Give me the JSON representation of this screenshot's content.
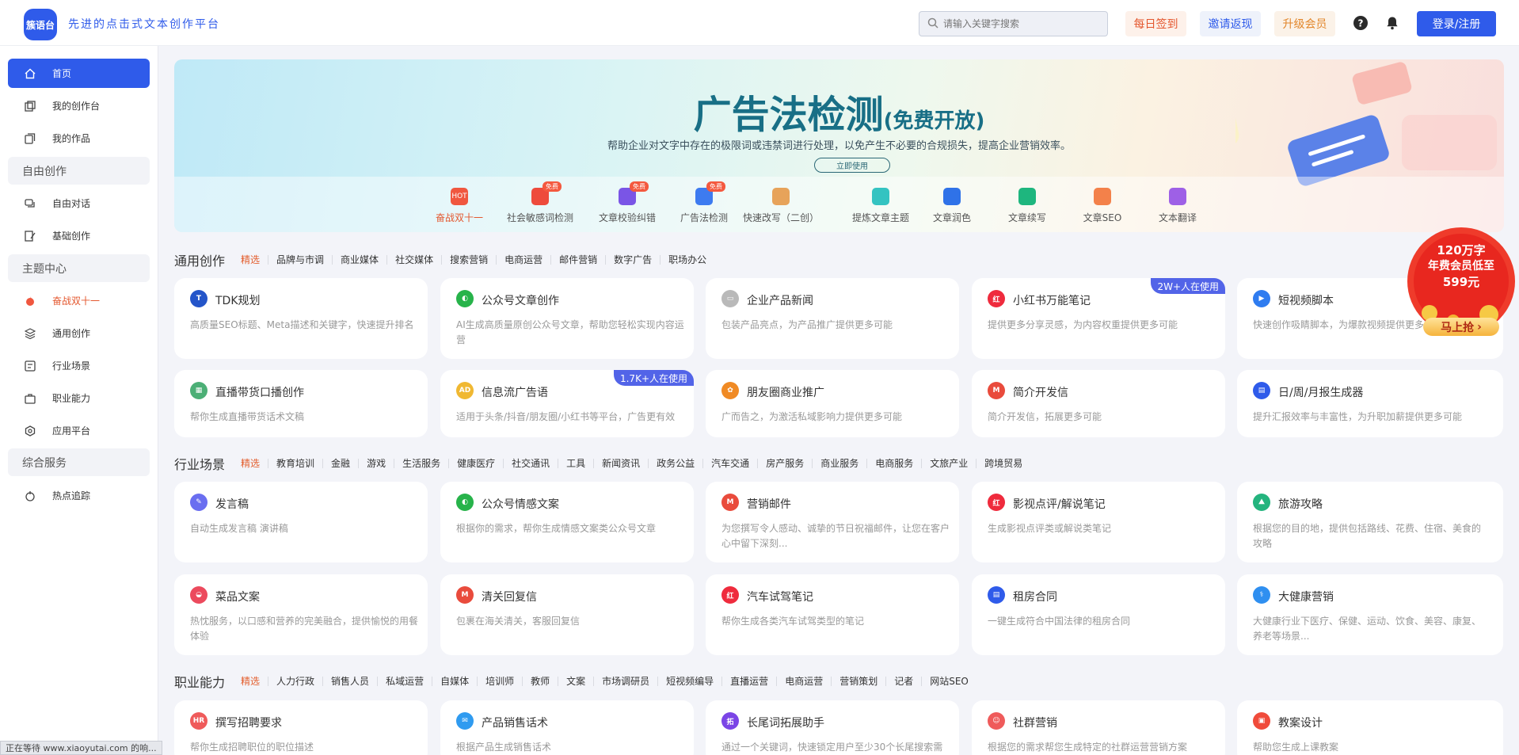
{
  "header": {
    "logo_text": "簇语台",
    "slogan": "先进的点击式文本创作平台",
    "search_placeholder": "请输入关键字搜索",
    "checkin": "每日签到",
    "invite": "邀请返现",
    "upgrade": "升级会员",
    "login": "登录/注册"
  },
  "sidebar": {
    "home": "首页",
    "workspace": "我的创作台",
    "works": "我的作品",
    "group_free": "自由创作",
    "free_chat": "自由对话",
    "basic": "基础创作",
    "group_theme": "主题中心",
    "double11": "奋战双十一",
    "general": "通用创作",
    "industry": "行业场景",
    "career": "职业能力",
    "platform": "应用平台",
    "group_service": "综合服务",
    "hot": "热点追踪"
  },
  "banner": {
    "title": "广告法检测",
    "title_suffix": "(免费开放)",
    "subtitle": "帮助企业对文字中存在的极限词或违禁词进行处理，以免产生不必要的合规损失，提高企业营销效率。",
    "button": "立即使用",
    "free_badge": "免费",
    "hot_badge": "HOT",
    "quick": [
      {
        "label": "奋战双十一",
        "color": "#f0573f",
        "icon": "fire-icon"
      },
      {
        "label": "社会敏感词检测",
        "color": "#ee4b3c",
        "icon": "shield-icon",
        "free": true
      },
      {
        "label": "文章校验纠错",
        "color": "#7a55e6",
        "icon": "check-icon",
        "free": true
      },
      {
        "label": "广告法检测",
        "color": "#3d7bf0",
        "icon": "ad-icon",
        "free": true
      },
      {
        "label": "快速改写（二创）",
        "color": "#e7a35a",
        "icon": "rewrite-icon"
      },
      {
        "label": "提炼文章主题",
        "color": "#34c3c1",
        "icon": "topic-icon"
      },
      {
        "label": "文章润色",
        "color": "#2f72e8",
        "icon": "polish-icon"
      },
      {
        "label": "文章续写",
        "color": "#1eb67e",
        "icon": "continue-icon"
      },
      {
        "label": "文章SEO",
        "color": "#f3814a",
        "icon": "seo-icon"
      },
      {
        "label": "文本翻译",
        "color": "#9e60e6",
        "icon": "translate-icon"
      }
    ]
  },
  "general": {
    "title": "通用创作",
    "tabs": [
      "精选",
      "品牌与市调",
      "商业媒体",
      "社交媒体",
      "搜索营销",
      "电商运营",
      "邮件营销",
      "数字广告",
      "职场办公"
    ],
    "cards": [
      {
        "title": "TDK规划",
        "desc": "高质量SEO标题、Meta描述和关键字，快速提升排名",
        "icon": "tdk-icon",
        "color": "#2455c9",
        "glyph": "T"
      },
      {
        "title": "公众号文章创作",
        "desc": "AI生成高质量原创公众号文章，帮助您轻松实现内容运营",
        "icon": "wechat-icon",
        "color": "#27b34a",
        "glyph": "◐"
      },
      {
        "title": "企业产品新闻",
        "desc": "包装产品亮点，为产品推广提供更多可能",
        "icon": "news-icon",
        "color": "#b9b9b9",
        "glyph": "▭"
      },
      {
        "title": "小红书万能笔记",
        "desc": "提供更多分享灵感，为内容权重提供更多可能",
        "icon": "xiaohongshu-icon",
        "color": "#ef2b3d",
        "glyph": "红",
        "users": "2W+人在使用"
      },
      {
        "title": "短视频脚本",
        "desc": "快速创作吸睛脚本，为爆款视频提供更多可能",
        "icon": "video-icon",
        "color": "#2f7cf0",
        "glyph": "▶"
      },
      {
        "title": "直播带货口播创作",
        "desc": "帮你生成直播带货话术文稿",
        "icon": "clapper-icon",
        "color": "#4caf76",
        "glyph": "▦"
      },
      {
        "title": "信息流广告语",
        "desc": "适用于头条/抖音/朋友圈/小红书等平台，广告更有效",
        "icon": "ad-text-icon",
        "color": "#f0b832",
        "glyph": "AD",
        "users": "1.7K+人在使用"
      },
      {
        "title": "朋友圈商业推广",
        "desc": "广而告之，为激活私域影响力提供更多可能",
        "icon": "moments-icon",
        "color": "#f08a24",
        "glyph": "✿"
      },
      {
        "title": "简介开发信",
        "desc": "简介开发信，拓展更多可能",
        "icon": "gmail-icon",
        "color": "#e94b3c",
        "glyph": "M"
      },
      {
        "title": "日/周/月报生成器",
        "desc": "提升汇报效率与丰富性，为升职加薪提供更多可能",
        "icon": "report-icon",
        "color": "#2f5bea",
        "glyph": "▤"
      }
    ]
  },
  "industry": {
    "title": "行业场景",
    "tabs": [
      "精选",
      "教育培训",
      "金融",
      "游戏",
      "生活服务",
      "健康医疗",
      "社交通讯",
      "工具",
      "新闻资讯",
      "政务公益",
      "汽车交通",
      "房产服务",
      "商业服务",
      "电商服务",
      "文旅产业",
      "跨境贸易"
    ],
    "cards": [
      {
        "title": "发言稿",
        "desc": "自动生成发言稿 演讲稿",
        "icon": "speech-icon",
        "color": "#6a6ef0",
        "glyph": "✎"
      },
      {
        "title": "公众号情感文案",
        "desc": "根据你的需求，帮你生成情感文案类公众号文章",
        "icon": "wechat-icon",
        "color": "#27b34a",
        "glyph": "◐"
      },
      {
        "title": "营销邮件",
        "desc": "为您撰写令人感动、诚挚的节日祝福邮件，让您在客户心中留下深刻...",
        "icon": "gmail-icon",
        "color": "#e94b3c",
        "glyph": "M"
      },
      {
        "title": "影视点评/解说笔记",
        "desc": "生成影视点评类或解说类笔记",
        "icon": "xiaohongshu-icon",
        "color": "#ef2b3d",
        "glyph": "红"
      },
      {
        "title": "旅游攻略",
        "desc": "根据您的目的地，提供包括路线、花费、住宿、美食的攻略",
        "icon": "travel-icon",
        "color": "#24b47e",
        "glyph": "⛰"
      },
      {
        "title": "菜品文案",
        "desc": "热忱服务，以口感和营养的完美融合，提供愉悦的用餐体验",
        "icon": "dish-icon",
        "color": "#ec4a5d",
        "glyph": "◒"
      },
      {
        "title": "清关回复信",
        "desc": "包裹在海关清关，客服回复信",
        "icon": "gmail-icon",
        "color": "#e94b3c",
        "glyph": "M"
      },
      {
        "title": "汽车试驾笔记",
        "desc": "帮你生成各类汽车试驾类型的笔记",
        "icon": "xiaohongshu-icon",
        "color": "#ef2b3d",
        "glyph": "红"
      },
      {
        "title": "租房合同",
        "desc": "一键生成符合中国法律的租房合同",
        "icon": "contract-icon",
        "color": "#2f5bea",
        "glyph": "▤"
      },
      {
        "title": "大健康营销",
        "desc": "大健康行业下医疗、保健、运动、饮食、美容、康复、养老等场景...",
        "icon": "health-icon",
        "color": "#2f8ff0",
        "glyph": "⚕"
      }
    ]
  },
  "career": {
    "title": "职业能力",
    "tabs": [
      "精选",
      "人力行政",
      "销售人员",
      "私域运营",
      "自媒体",
      "培训师",
      "教师",
      "文案",
      "市场调研员",
      "短视频编导",
      "直播运营",
      "电商运营",
      "营销策划",
      "记者",
      "网站SEO"
    ],
    "cards": [
      {
        "title": "撰写招聘要求",
        "desc": "帮你生成招聘职位的职位描述",
        "icon": "hr-icon",
        "color": "#ef5b5b",
        "glyph": "HR"
      },
      {
        "title": "产品销售话术",
        "desc": "根据产品生成销售话术",
        "icon": "chat-icon",
        "color": "#2f9bf0",
        "glyph": "✉"
      },
      {
        "title": "长尾词拓展助手",
        "desc": "通过一个关键词，快速锁定用户至少30个长尾搜索需",
        "icon": "expand-icon",
        "color": "#7b45e6",
        "glyph": "拓"
      },
      {
        "title": "社群营销",
        "desc": "根据您的需求帮您生成特定的社群运营营销方案",
        "icon": "group-icon",
        "color": "#ef5b5b",
        "glyph": "☺"
      },
      {
        "title": "教案设计",
        "desc": "帮助您生成上课教案",
        "icon": "lesson-icon",
        "color": "#f04b3b",
        "glyph": "▣"
      }
    ]
  },
  "promo": {
    "line1": "120万字",
    "line2": "年费会员低至",
    "line3": "599元",
    "cta": "马上抢"
  },
  "status": "正在等待 www.xiaoyutai.com 的响..."
}
